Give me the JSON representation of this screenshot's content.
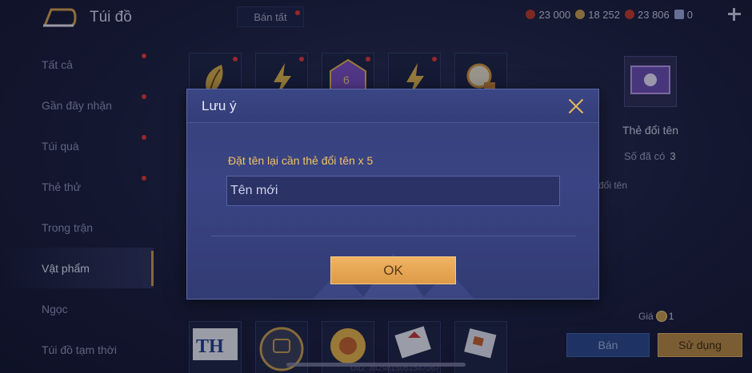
{
  "header": {
    "title": "Túi đồ",
    "sell_all_label": "Bán tất",
    "currencies": [
      {
        "icon": "ruby-icon",
        "value": "23 000",
        "color": "#c0392b"
      },
      {
        "icon": "gold-coin-icon",
        "value": "18 252",
        "color": "#c9a04d"
      },
      {
        "icon": "gem-icon",
        "value": "23 806",
        "color": "#c0392b"
      },
      {
        "icon": "voucher-icon",
        "value": "0",
        "color": "#9aa6d8"
      }
    ]
  },
  "sidebar": {
    "items": [
      {
        "label": "Tất cả",
        "badge": true
      },
      {
        "label": "Gần đây nhận",
        "badge": true
      },
      {
        "label": "Túi quà",
        "badge": true
      },
      {
        "label": "Thẻ thử",
        "badge": true
      },
      {
        "label": "Trong trận",
        "badge": false
      },
      {
        "label": "Vật phẩm",
        "badge": false,
        "active": true
      },
      {
        "label": "Ngọc",
        "badge": false
      },
      {
        "label": "Túi đồ tạm thời",
        "badge": false
      }
    ]
  },
  "grid": {
    "top_row": [
      "leaf-emblem-icon",
      "lightning-icon",
      "dice-icon",
      "lightning-icon",
      "lantern-icon"
    ],
    "bottom_row": [
      "th-card-icon",
      "hand-touch-icon",
      "sunflower-emblem-icon",
      "id-card-icon",
      "notebook-icon"
    ]
  },
  "detail": {
    "name": "Thẻ đổi tên",
    "owned_label": "Số đã có",
    "owned_value": "3",
    "description": "đổi tên",
    "price_label": "Giá",
    "price_value": "1",
    "sell_label": "Bán",
    "use_label": "Sử dụng"
  },
  "uid_text": "UID: 3429815051547067",
  "modal": {
    "title": "Lưu ý",
    "message": "Đặt tên lại cần thẻ đổi tên x 5",
    "input_value": "Tên mới",
    "ok_label": "OK"
  }
}
